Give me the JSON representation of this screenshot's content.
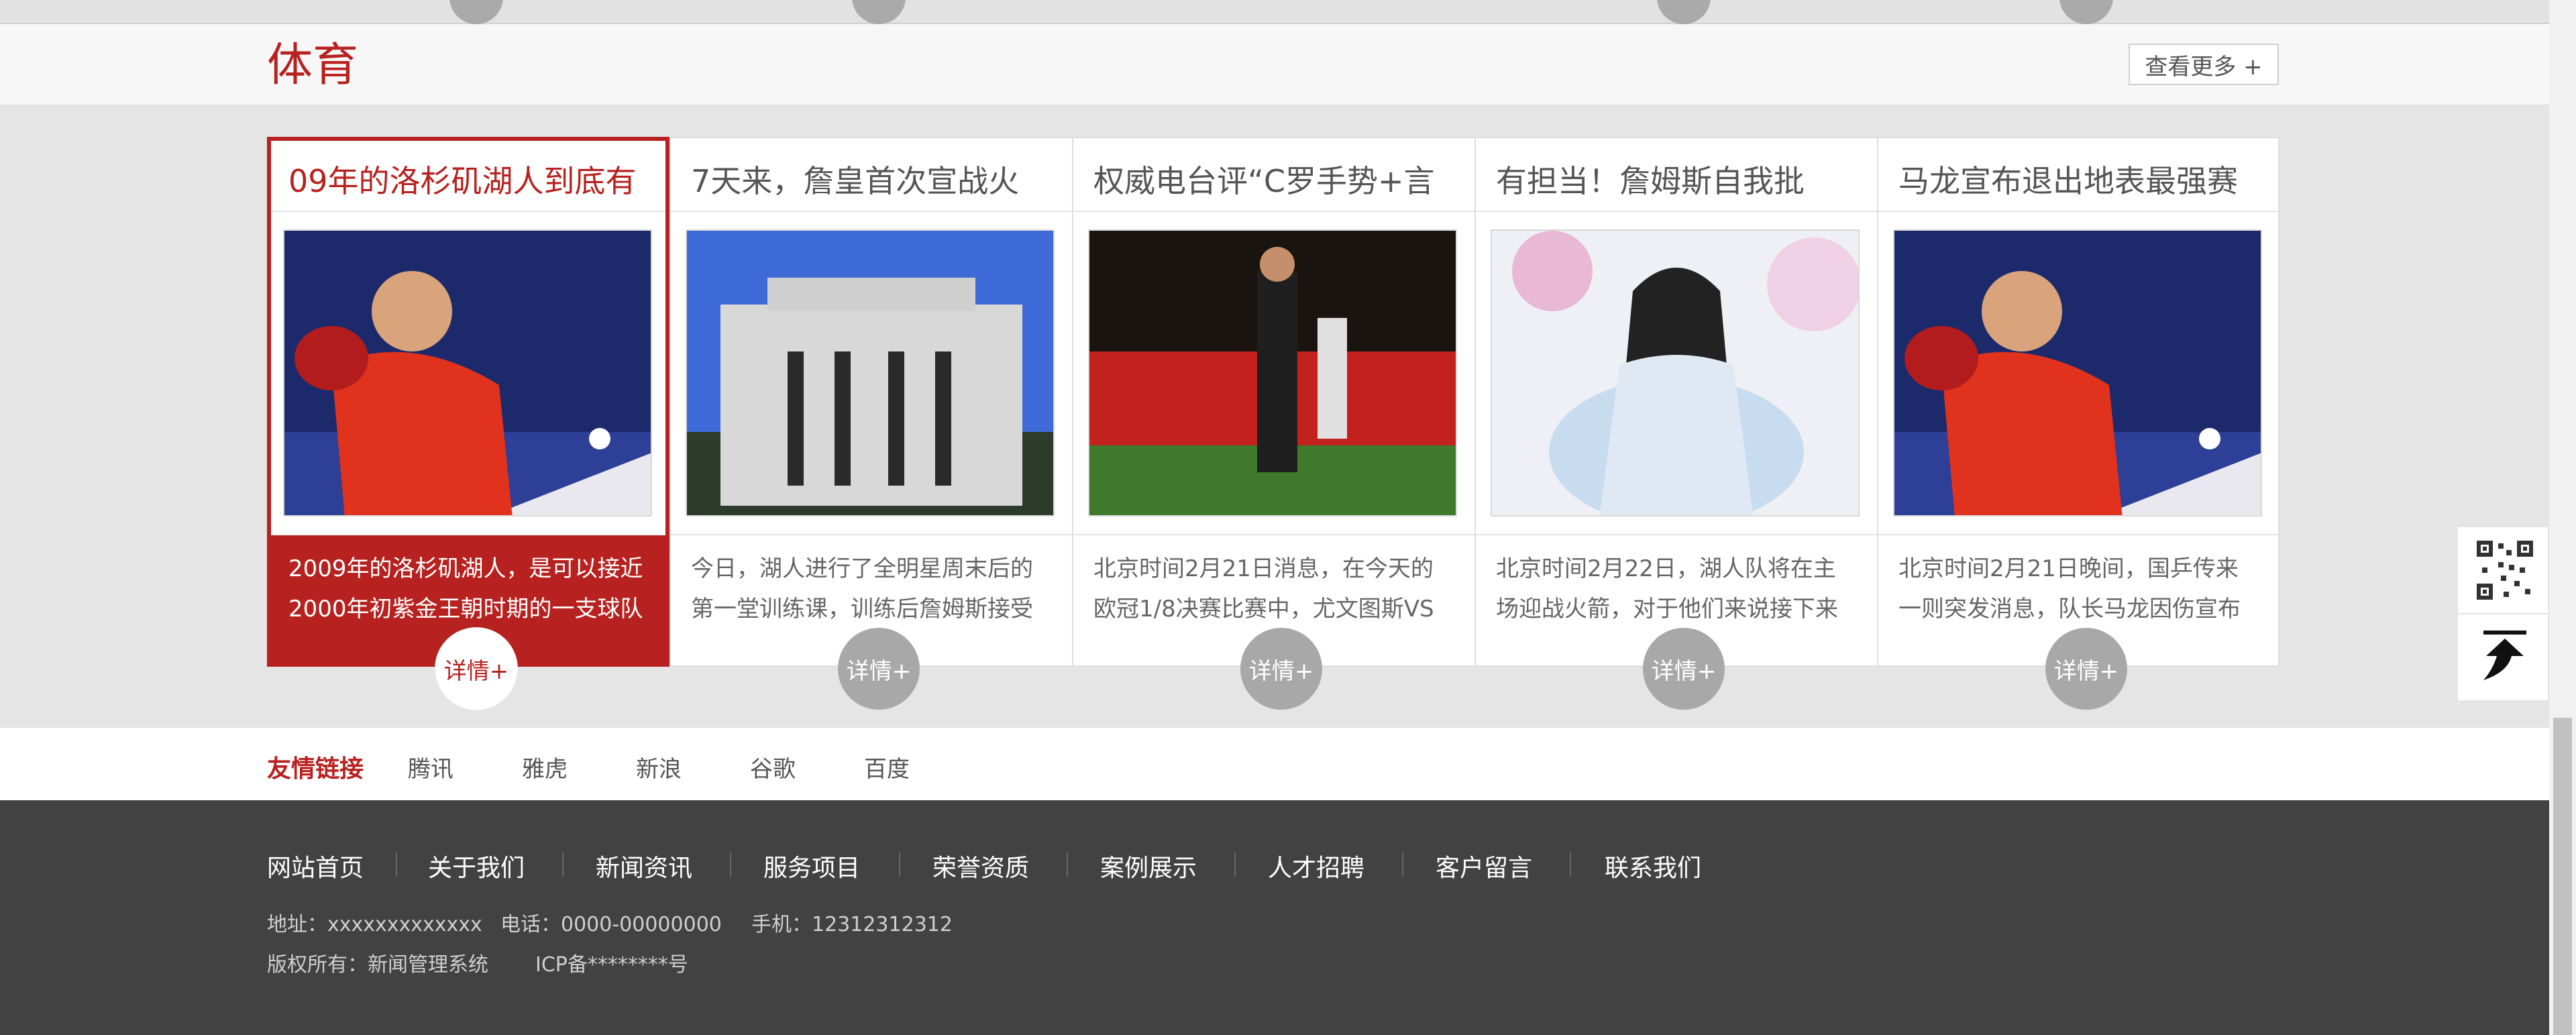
{
  "section": {
    "title": "体育",
    "more_label": "查看更多 +"
  },
  "cards": [
    {
      "title": "09年的洛杉矶湖人到底有",
      "desc_line1": "2009年的洛杉矶湖人，是可以接近",
      "desc_line2": "2000年初紫金王朝时期的一支球队",
      "detail_label": "详情+",
      "image_icon": "table-tennis-player-photo"
    },
    {
      "title": "7天来，詹皇首次宣战火",
      "desc_line1": "今日，湖人进行了全明星周末后的",
      "desc_line2": "第一堂训练课，训练后詹姆斯接受",
      "detail_label": "详情+",
      "image_icon": "government-building-photo"
    },
    {
      "title": "权威电台评“C罗手势+言",
      "desc_line1": "北京时间2月21日消息，在今天的",
      "desc_line2": "欧冠1/8决赛比赛中，尤文图斯VS",
      "detail_label": "详情+",
      "image_icon": "soccer-player-photo"
    },
    {
      "title": "有担当！詹姆斯自我批",
      "desc_line1": "北京时间2月22日，湖人队将在主",
      "desc_line2": "场迎战火箭，对于他们来说接下来",
      "detail_label": "详情+",
      "image_icon": "fantasy-illustration-photo"
    },
    {
      "title": "马龙宣布退出地表最强赛",
      "desc_line1": "北京时间2月21日晚间，国乒传来",
      "desc_line2": "一则突发消息，队长马龙因伤宣布",
      "detail_label": "详情+",
      "image_icon": "table-tennis-player-photo"
    }
  ],
  "friend_links": {
    "label": "友情链接",
    "items": [
      "腾讯",
      "雅虎",
      "新浪",
      "谷歌",
      "百度"
    ]
  },
  "footer": {
    "nav": [
      "网站首页",
      "关于我们",
      "新闻资讯",
      "服务项目",
      "荣誉资质",
      "案例展示",
      "人才招聘",
      "客户留言",
      "联系我们"
    ],
    "address": "地址：xxxxxxxxxxxxx",
    "phone": "电话：0000-00000000",
    "mobile": "手机：12312312312",
    "copyright": "版权所有：新闻管理系统",
    "icp": "ICP备********号"
  },
  "side_panel": {
    "qr_icon": "qr-code-icon",
    "top_icon": "back-to-top-icon"
  },
  "colors": {
    "accent": "#b7211f",
    "footer_bg": "#424242",
    "detail_btn": "#a8a8a8"
  }
}
